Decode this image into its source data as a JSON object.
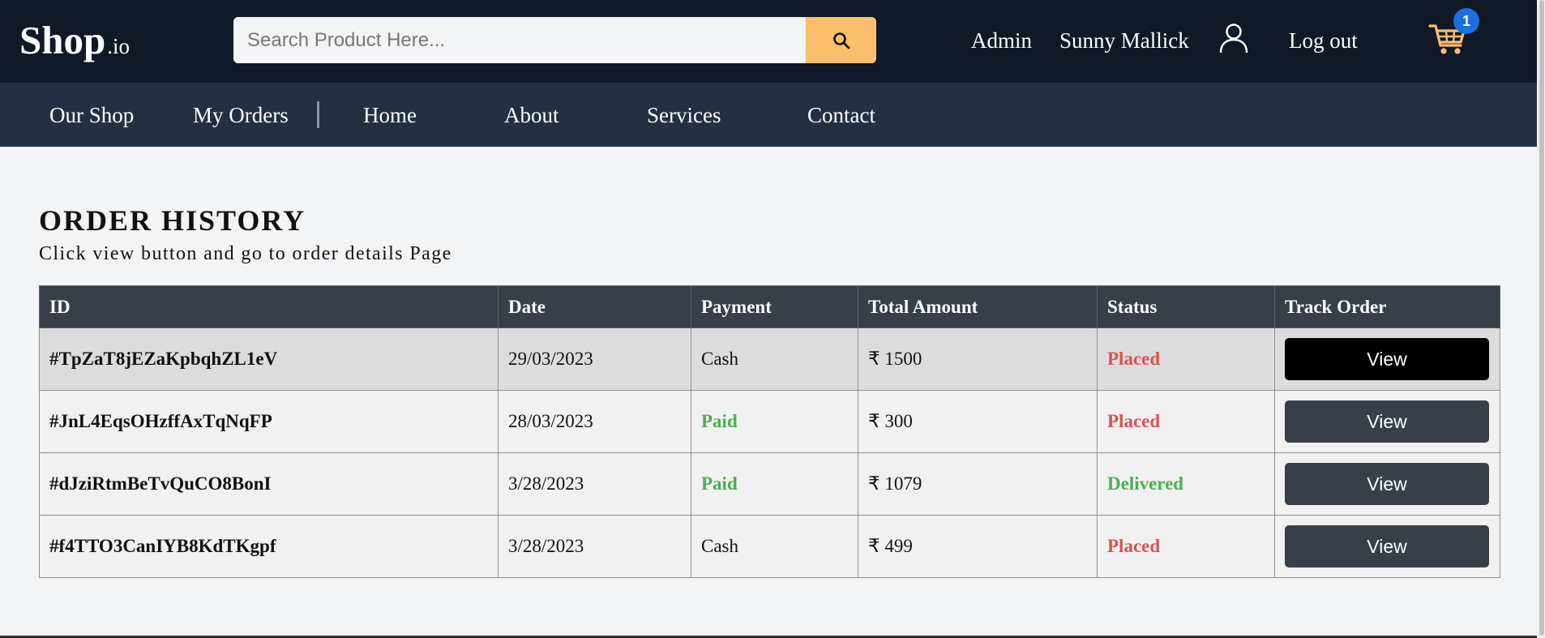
{
  "header": {
    "logo_main": "Shop",
    "logo_tld": ".io",
    "search": {
      "placeholder": "Search Product Here..."
    },
    "links": {
      "admin": "Admin",
      "user": "Sunny Mallick",
      "logout": "Log out"
    },
    "cart_count": "1",
    "icons": {
      "search": "search-icon",
      "user": "user-icon",
      "cart": "cart-icon"
    },
    "colors": {
      "bg": "#111827",
      "accent": "#fbbf6b",
      "badge": "#1d6fe0"
    }
  },
  "subnav": {
    "items": [
      "Our Shop",
      "My Orders",
      "Home",
      "About",
      "Services",
      "Contact"
    ],
    "bg": "#233044"
  },
  "main": {
    "title": "ORDER HISTORY",
    "subtitle": "Click view button and go to order details Page",
    "table": {
      "columns": [
        "ID",
        "Date",
        "Payment",
        "Total Amount",
        "Status",
        "Track Order"
      ],
      "rows": [
        {
          "id": "#TpZaT8jEZaKpbqhZL1eV",
          "date": "29/03/2023",
          "payment": "Cash",
          "amount": "₹ 1500",
          "status": "Placed",
          "action": "View"
        },
        {
          "id": "#JnL4EqsOHzffAxTqNqFP",
          "date": "28/03/2023",
          "payment": "Paid",
          "amount": "₹ 300",
          "status": "Placed",
          "action": "View"
        },
        {
          "id": "#dJziRtmBeTvQuCO8BonI",
          "date": "3/28/2023",
          "payment": "Paid",
          "amount": "₹ 1079",
          "status": "Delivered",
          "action": "View"
        },
        {
          "id": "#f4TTO3CanIYB8KdTKgpf",
          "date": "3/28/2023",
          "payment": "Cash",
          "amount": "₹ 499",
          "status": "Placed",
          "action": "View"
        }
      ]
    },
    "status_colors": {
      "placed": "#d9534f",
      "delivered": "#4caf50",
      "paid": "#4caf50"
    }
  }
}
